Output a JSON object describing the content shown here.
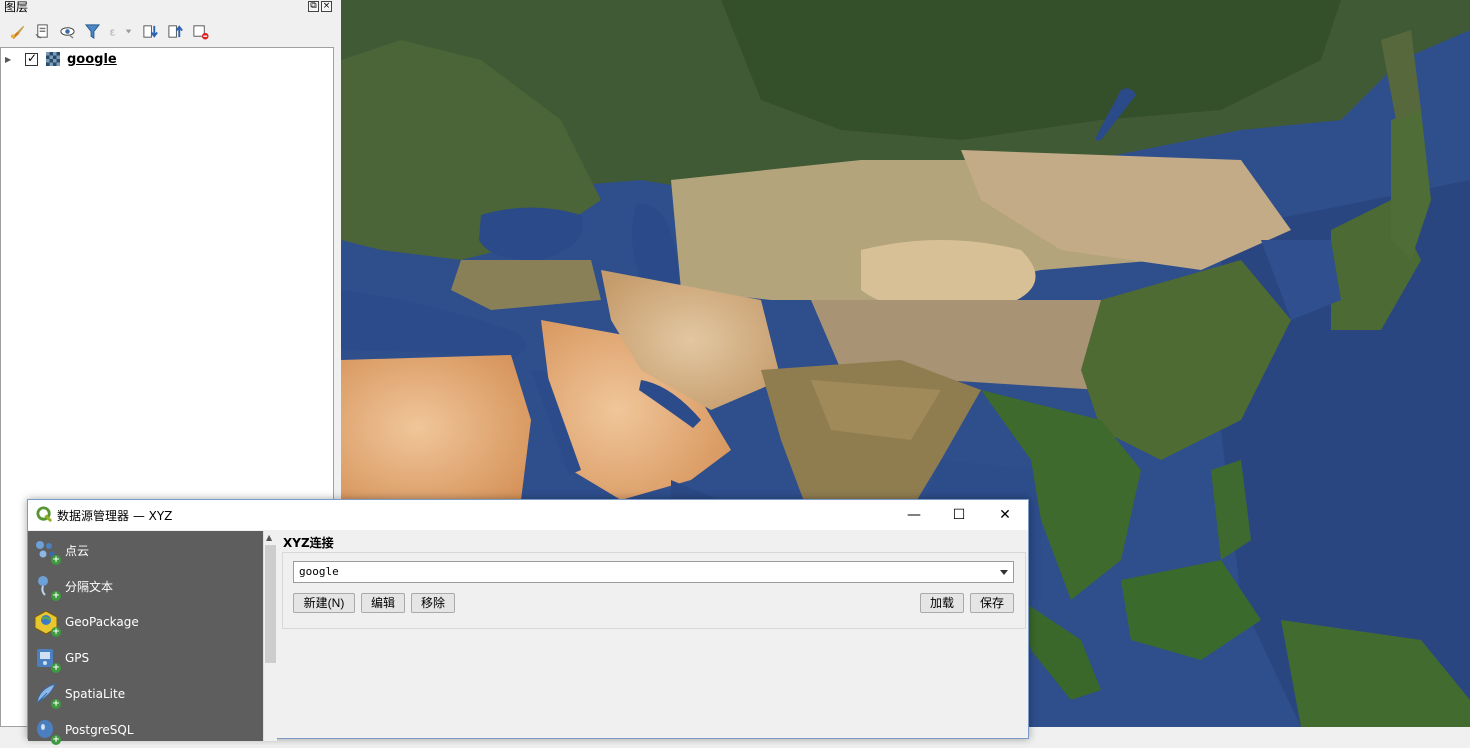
{
  "layers_panel": {
    "title": "图层",
    "toolbar_icons": [
      "style-brush-icon",
      "add-group-icon",
      "eye-visibility-icon",
      "filter-icon",
      "filter-expression-icon",
      "expand-all-icon",
      "collapse-all-icon",
      "remove-layer-icon"
    ],
    "layers": [
      {
        "name": "google",
        "checked": true,
        "type": "raster"
      }
    ]
  },
  "dialog": {
    "title": "数据源管理器 — XYZ",
    "providers": [
      {
        "label": "点云",
        "icon": "point-cloud-icon"
      },
      {
        "label": "分隔文本",
        "icon": "delimited-text-icon"
      },
      {
        "label": "GeoPackage",
        "icon": "geopackage-icon"
      },
      {
        "label": "GPS",
        "icon": "gps-icon"
      },
      {
        "label": "SpatiaLite",
        "icon": "spatialite-icon"
      },
      {
        "label": "PostgreSQL",
        "icon": "postgresql-icon"
      }
    ],
    "section_label": "XYZ连接",
    "connection_value": "google",
    "buttons": {
      "new": "新建(N)",
      "edit": "编辑",
      "remove": "移除",
      "load": "加载",
      "save": "保存"
    }
  }
}
